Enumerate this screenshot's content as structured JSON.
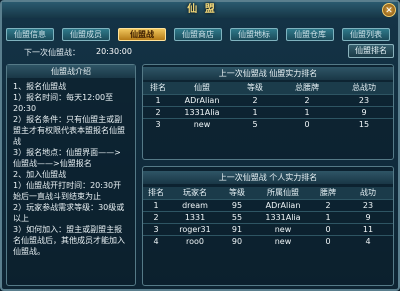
{
  "window": {
    "title": "仙 盟",
    "close_label": "✕"
  },
  "tabs": [
    {
      "label": "仙盟信息",
      "active": false
    },
    {
      "label": "仙盟成员",
      "active": false
    },
    {
      "label": "仙盟战",
      "active": true
    },
    {
      "label": "仙盟商店",
      "active": false
    },
    {
      "label": "仙盟地标",
      "active": false
    },
    {
      "label": "仙盟仓库",
      "active": false
    },
    {
      "label": "仙盟列表",
      "active": false
    }
  ],
  "timer": {
    "label": "下一次仙盟战：",
    "value": "20:30:00"
  },
  "rank_button": {
    "label": "仙盟排名"
  },
  "intro": {
    "title": "仙盟战介绍",
    "lines": [
      "1、报名仙盟战",
      "1）报名时间：每天12:00至",
      "20:30",
      "2）报名条件：只有仙盟主或副",
      "盟主才有权限代表本盟报名仙盟",
      "战",
      "3）报名地点：仙盟界面——>",
      "仙盟战——>仙盟报名",
      "2、加入仙盟战",
      "1）仙盟战开打时间：20:30开",
      "始后一直战斗到结束为止",
      "2）玩家参战需求等级：30级或",
      "以上",
      "3）如何加入：盟主或副盟主报",
      "名仙盟战后，其他成员才能加入",
      "仙盟战。"
    ]
  },
  "guild_rank": {
    "title": "上一次仙盟战 仙盟实力排名",
    "headers": [
      "排名",
      "仙盟",
      "等级",
      "总腰牌",
      "总战功"
    ],
    "rows": [
      [
        "1",
        "ADrAlian",
        "2",
        "2",
        "23"
      ],
      [
        "2",
        "1331Alia",
        "1",
        "1",
        "9"
      ],
      [
        "3",
        "new",
        "5",
        "0",
        "15"
      ]
    ]
  },
  "player_rank": {
    "title": "上一次仙盟战 个人实力排名",
    "headers": [
      "排名",
      "玩家名",
      "等级",
      "所属仙盟",
      "腰牌",
      "战功"
    ],
    "rows": [
      [
        "1",
        "dream",
        "95",
        "ADrAlian",
        "2",
        "23"
      ],
      [
        "2",
        "1331",
        "55",
        "1331Alia",
        "1",
        "9"
      ],
      [
        "3",
        "roger31",
        "91",
        "new",
        "0",
        "11"
      ],
      [
        "4",
        "roo0",
        "90",
        "new",
        "0",
        "4"
      ]
    ]
  }
}
